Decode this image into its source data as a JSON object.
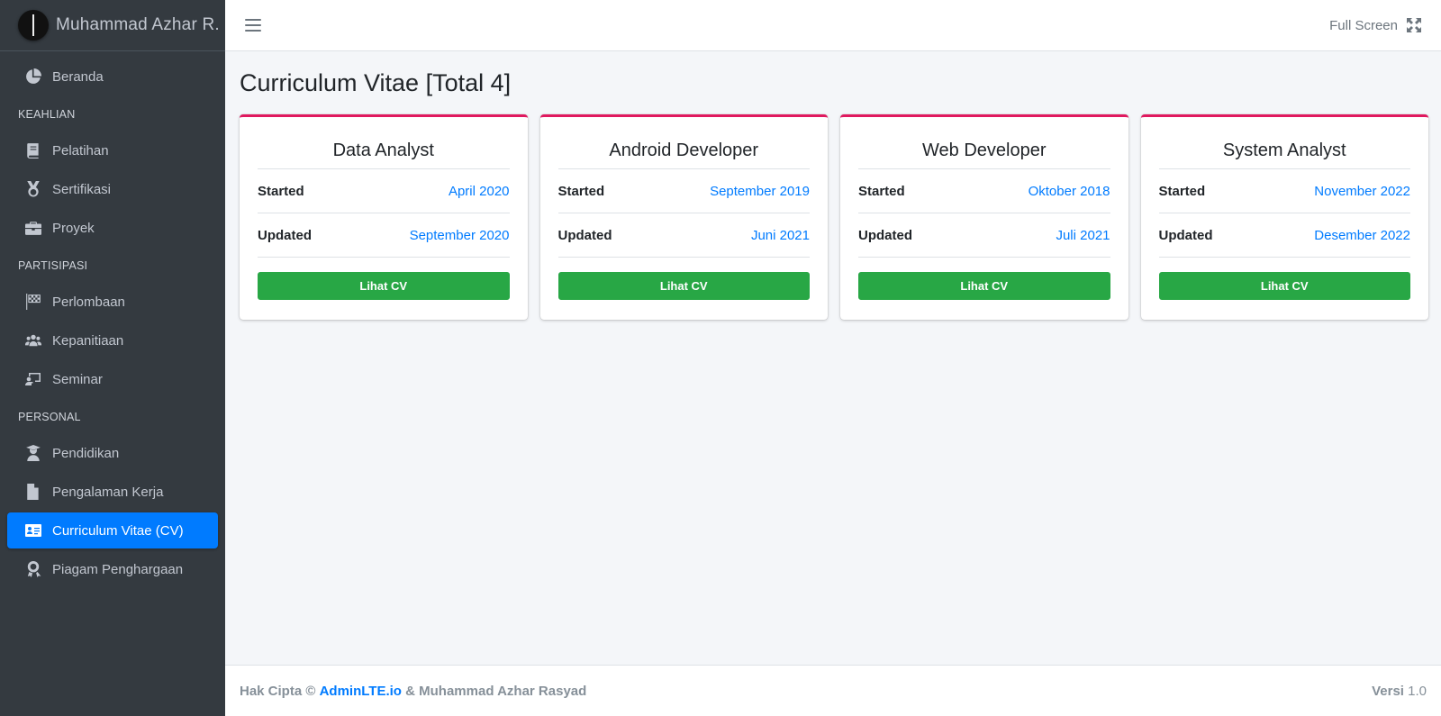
{
  "brand": {
    "name": "Muhammad Azhar R."
  },
  "sidebar": {
    "beranda": "Beranda",
    "header_keahlian": "KEAHLIAN",
    "pelatihan": "Pelatihan",
    "sertifikasi": "Sertifikasi",
    "proyek": "Proyek",
    "header_partisipasi": "PARTISIPASI",
    "perlombaan": "Perlombaan",
    "kepanitiaan": "Kepanitiaan",
    "seminar": "Seminar",
    "header_personal": "PERSONAL",
    "pendidikan": "Pendidikan",
    "pengalaman": "Pengalaman Kerja",
    "cv": "Curriculum Vitae (CV)",
    "piagam": "Piagam Penghargaan"
  },
  "topbar": {
    "fullscreen_label": "Full Screen"
  },
  "page": {
    "title": "Curriculum Vitae [Total 4]"
  },
  "cards": [
    {
      "title": "Data Analyst",
      "started_label": "Started",
      "started": "April 2020",
      "updated_label": "Updated",
      "updated": "September 2020",
      "button": "Lihat CV"
    },
    {
      "title": "Android Developer",
      "started_label": "Started",
      "started": "September 2019",
      "updated_label": "Updated",
      "updated": "Juni 2021",
      "button": "Lihat CV"
    },
    {
      "title": "Web Developer",
      "started_label": "Started",
      "started": "Oktober 2018",
      "updated_label": "Updated",
      "updated": "Juli 2021",
      "button": "Lihat CV"
    },
    {
      "title": "System Analyst",
      "started_label": "Started",
      "started": "November 2022",
      "updated_label": "Updated",
      "updated": "Desember 2022",
      "button": "Lihat CV"
    }
  ],
  "footer": {
    "prefix": "Hak Cipta ©",
    "link": "AdminLTE.io",
    "suffix": "& Muhammad Azhar Rasyad",
    "version_label": "Versi",
    "version": "1.0"
  },
  "colors": {
    "primary": "#007bff",
    "success": "#28a745",
    "card_accent": "#e0195f",
    "sidebar_bg": "#343a40"
  }
}
